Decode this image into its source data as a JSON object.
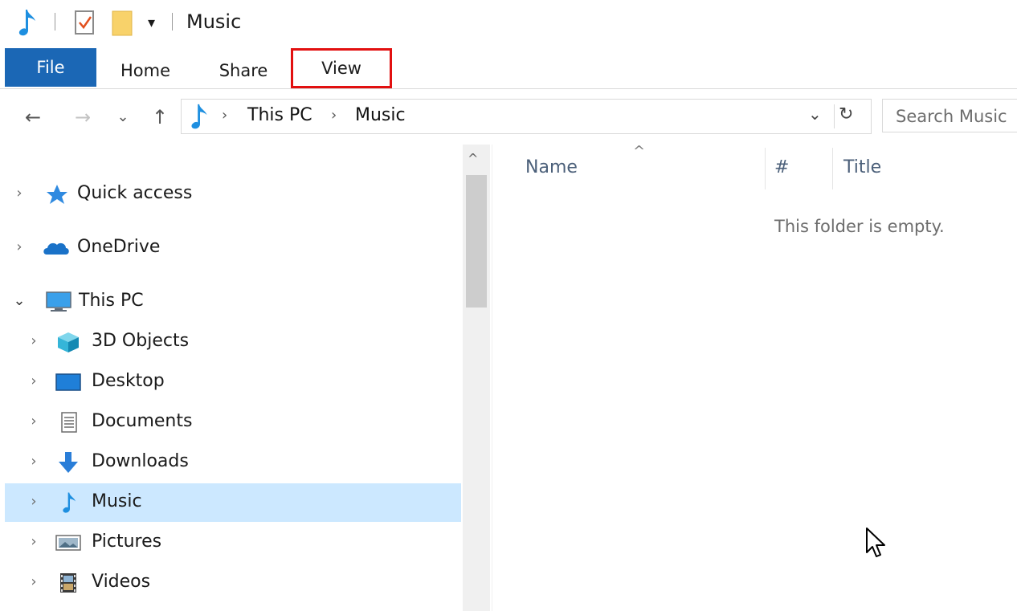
{
  "window": {
    "title": "Music",
    "quick_access_dropdown": "▾"
  },
  "ribbon": {
    "tabs": [
      "File",
      "Home",
      "Share",
      "View"
    ]
  },
  "nav": {
    "back": "←",
    "forward": "→",
    "recent": "⌄",
    "up": "↑",
    "breadcrumb": [
      "This PC",
      "Music"
    ],
    "crumb_sep": "›",
    "dropdown": "⌄",
    "refresh": "↻",
    "search_placeholder": "Search Music"
  },
  "navpane": {
    "items": [
      {
        "label": "Quick access",
        "icon": "star-icon",
        "chevron": "›"
      },
      {
        "label": "OneDrive",
        "icon": "cloud-icon",
        "chevron": "›"
      },
      {
        "label": "This PC",
        "icon": "computer-icon",
        "chevron": "⌄"
      },
      {
        "label": "3D Objects",
        "icon": "cube-icon",
        "chevron": "›"
      },
      {
        "label": "Desktop",
        "icon": "desktop-icon",
        "chevron": "›"
      },
      {
        "label": "Documents",
        "icon": "document-icon",
        "chevron": "›"
      },
      {
        "label": "Downloads",
        "icon": "download-arrow-icon",
        "chevron": "›"
      },
      {
        "label": "Music",
        "icon": "music-note-icon",
        "chevron": "›",
        "selected": true
      },
      {
        "label": "Pictures",
        "icon": "picture-icon",
        "chevron": "›"
      },
      {
        "label": "Videos",
        "icon": "film-icon",
        "chevron": "›"
      }
    ],
    "scroll_up": "^"
  },
  "content": {
    "columns": [
      "Name",
      "#",
      "Title"
    ],
    "sort_indicator": "^",
    "empty_message": "This folder is empty."
  },
  "colors": {
    "accent": "#1b67b5",
    "selection": "#cce8ff",
    "highlight_box": "#e21010"
  }
}
